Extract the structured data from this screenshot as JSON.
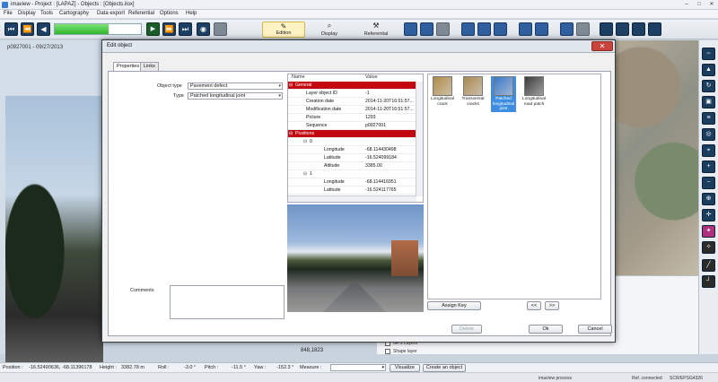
{
  "window": {
    "title": "imaview - Project : [LAPAZ] - Objects : [Objects.ilox]",
    "minimize": "–",
    "maximize": "□",
    "close": "✕"
  },
  "menu": [
    "File",
    "Display",
    "Tools",
    "Cartography",
    "Data export",
    "Referential",
    "Options",
    "Help"
  ],
  "toolbar": {
    "progress_fraction": 0.62,
    "modes": [
      {
        "label": "Edition",
        "icon": "pencil-icon",
        "active": true
      },
      {
        "label": "Display",
        "icon": "magnifier-icon",
        "active": false
      },
      {
        "label": "Referential",
        "icon": "tools-icon",
        "active": false
      }
    ]
  },
  "left_panel": {
    "caption": "p0927001 - 09/27/2013"
  },
  "dialog": {
    "title": "Edit object",
    "close": "✕",
    "tabs": [
      "Properties",
      "Links"
    ],
    "object_type_label": "Object type",
    "object_type_value": "Pavement defect",
    "type_label": "Type",
    "type_value": "Patched longitudinal joint",
    "comments_label": "Comments",
    "grid": {
      "headers": {
        "name": "Name",
        "value": "Value"
      },
      "rows": [
        {
          "kind": "section",
          "name": "General",
          "value": ""
        },
        {
          "kind": "prop",
          "name": "Layer object ID",
          "value": "-1"
        },
        {
          "kind": "prop",
          "name": "Creation date",
          "value": "2014-11-20T16:51:57..."
        },
        {
          "kind": "prop",
          "name": "Modification date",
          "value": "2014-11-20T16:51:57..."
        },
        {
          "kind": "prop",
          "name": "Picture",
          "value": "1293"
        },
        {
          "kind": "prop",
          "name": "Sequence",
          "value": "p0927001"
        },
        {
          "kind": "section",
          "name": "Positions",
          "value": ""
        },
        {
          "kind": "group",
          "name": "0",
          "value": ""
        },
        {
          "kind": "sub",
          "name": "Longitude",
          "value": "-68.114430498"
        },
        {
          "kind": "sub",
          "name": "Latitude",
          "value": "-16.524099184"
        },
        {
          "kind": "sub",
          "name": "Altitude",
          "value": "3385.00"
        },
        {
          "kind": "group",
          "name": "1",
          "value": ""
        },
        {
          "kind": "sub",
          "name": "Longitude",
          "value": "-68.114416951"
        },
        {
          "kind": "sub",
          "name": "Latitude",
          "value": "-16.524117765"
        }
      ]
    },
    "catalog": [
      {
        "label": "Longitudinal crack",
        "color": "#b08c4a",
        "selected": false
      },
      {
        "label": "Transversal cracks",
        "color": "#a88a52",
        "selected": false
      },
      {
        "label": "Patched longitudinal joint",
        "color": "#3a78c8",
        "selected": true
      },
      {
        "label": "Longitudinal road patch",
        "color": "#3b3b3b",
        "selected": false
      }
    ],
    "assign_key": "Assign Key",
    "prev": "<<",
    "next": ">>",
    "delete": "Delete",
    "ok": "Ok",
    "cancel": "Cancel"
  },
  "under_dialog": {
    "number": "848,1823",
    "layers": [
      "GPS Layers",
      "Shape layer"
    ]
  },
  "status": {
    "position_label": "Position :",
    "position_value": "-16.52490636, -68.11396178",
    "height_label": "Height :",
    "height_value": "3382.78 m",
    "roll_label": "Roll :",
    "roll_value": "-3.0 °",
    "pitch_label": "Pitch :",
    "pitch_value": "-11.5 °",
    "yaw_label": "Yaw :",
    "yaw_value": "-152.3 °",
    "measure_label": "Measure :",
    "visualize": "Visualize",
    "create": "Create an object"
  },
  "bottom": {
    "process": "imaview process",
    "connected": "Ref. connected",
    "srs": "SCR/EPSG4326"
  }
}
